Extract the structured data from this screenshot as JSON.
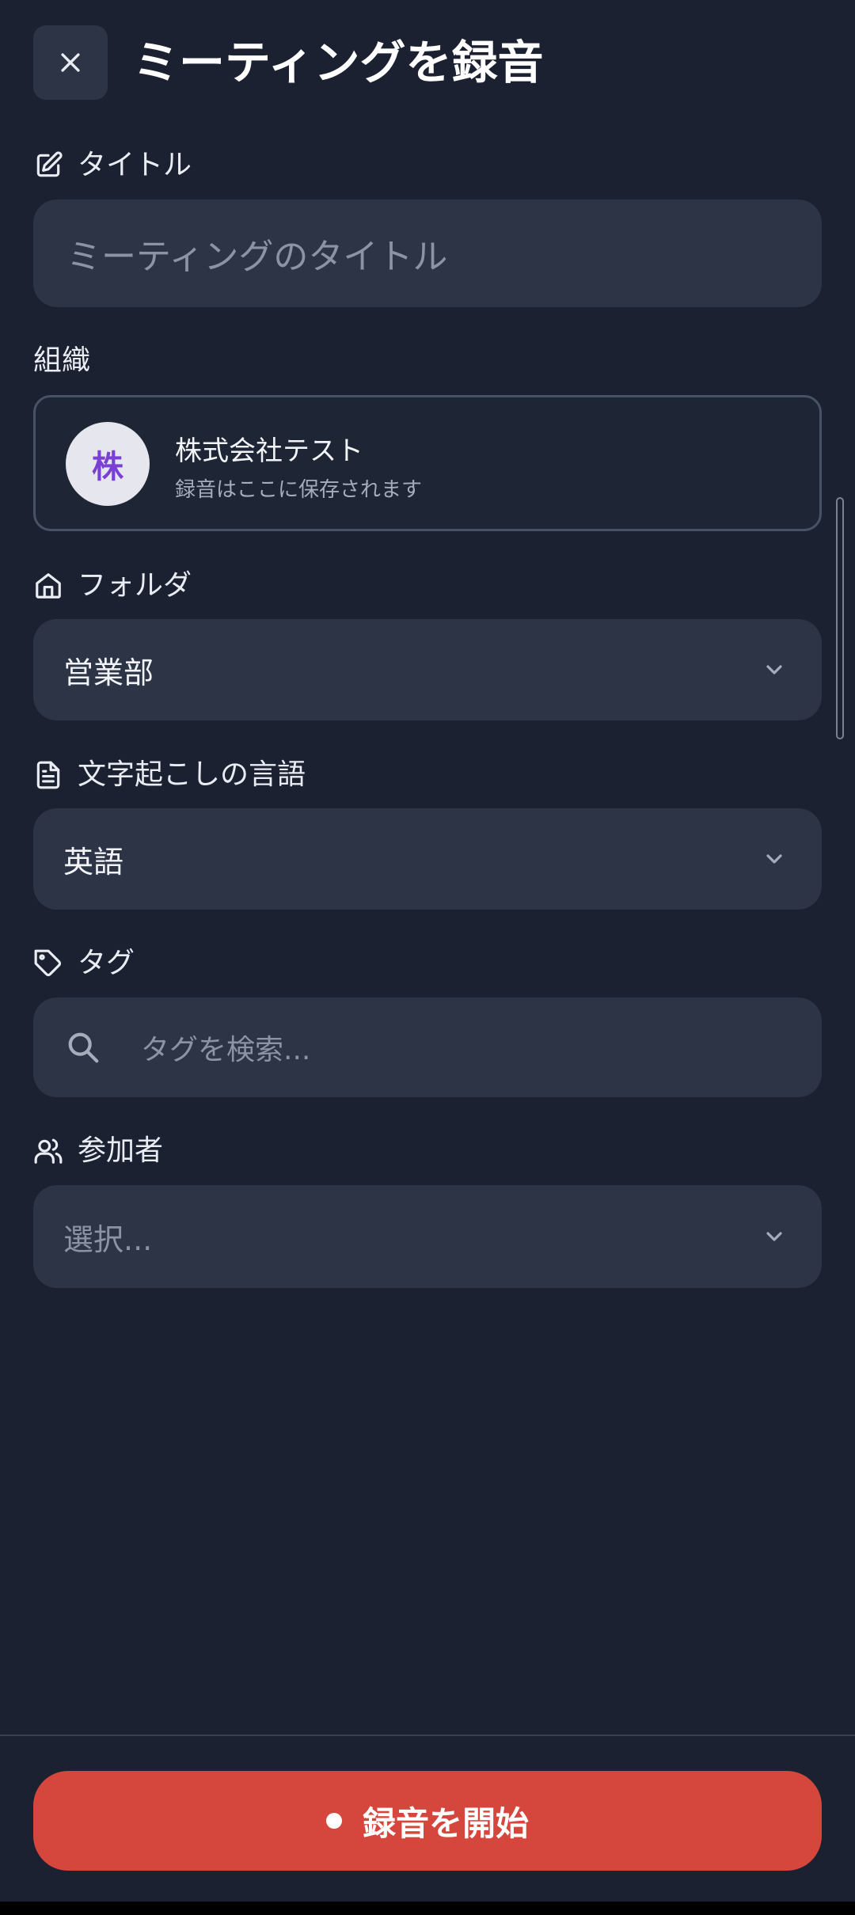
{
  "header": {
    "title": "ミーティングを録音",
    "close_icon": "close-icon"
  },
  "title_field": {
    "label": "タイトル",
    "icon": "edit-icon",
    "placeholder": "ミーティングのタイトル",
    "value": ""
  },
  "organization": {
    "label": "組織",
    "avatar_text": "株",
    "name": "株式会社テスト",
    "subtitle": "録音はここに保存されます"
  },
  "folder": {
    "label": "フォルダ",
    "icon": "home-icon",
    "selected": "営業部"
  },
  "language": {
    "label": "文字起こしの言語",
    "icon": "document-icon",
    "selected": "英語"
  },
  "tags": {
    "label": "タグ",
    "icon": "tag-icon",
    "placeholder": "タグを検索..."
  },
  "participants": {
    "label": "参加者",
    "icon": "users-icon",
    "placeholder": "選択..."
  },
  "start_button": {
    "label": "録音を開始"
  },
  "colors": {
    "background": "#1b2130",
    "field": "#2c3446",
    "accent_red": "#d5473d",
    "avatar_text": "#7a3fd4"
  }
}
